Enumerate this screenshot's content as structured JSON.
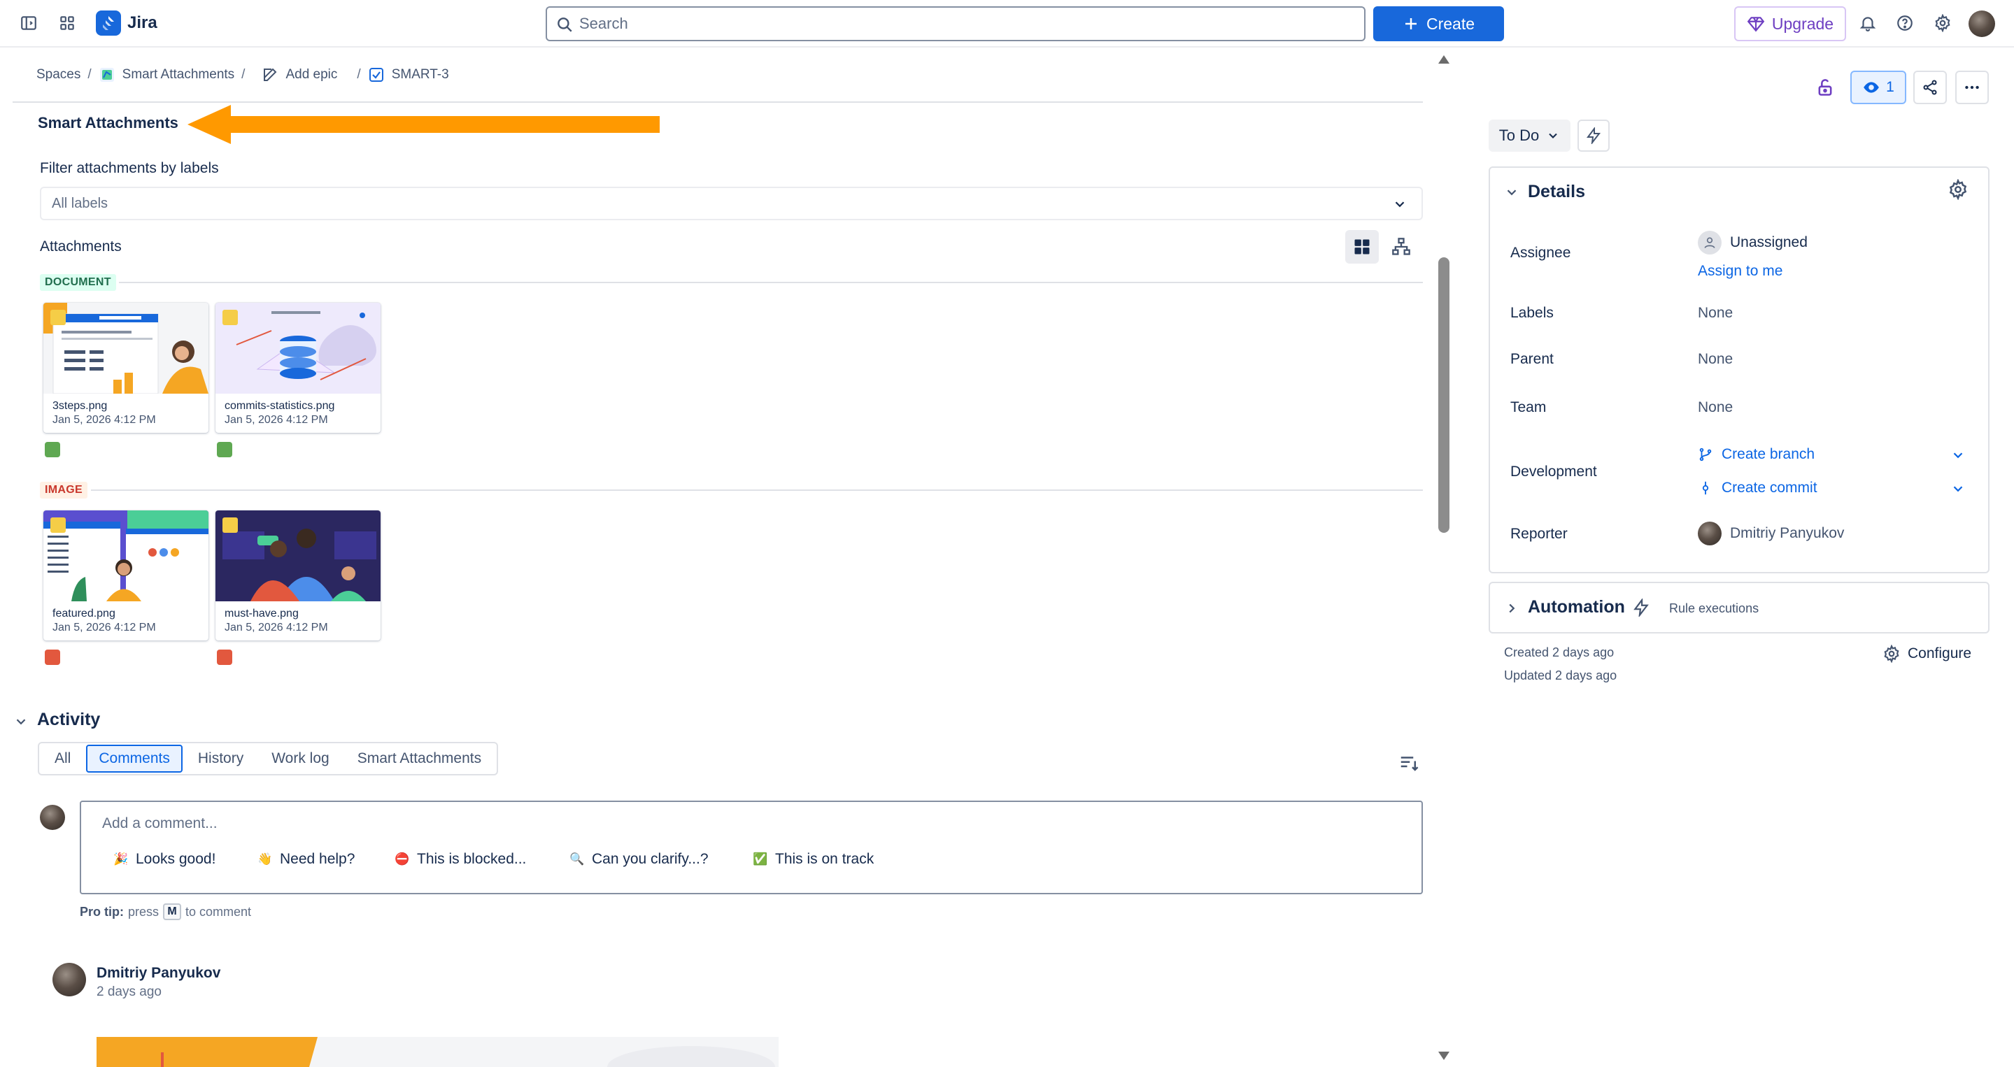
{
  "topnav": {
    "app_name": "Jira",
    "search_placeholder": "Search",
    "create_label": "Create",
    "upgrade_label": "Upgrade",
    "icons": [
      "sidebar-toggle-icon",
      "app-switcher-icon",
      "bell-icon",
      "help-icon",
      "settings-icon"
    ]
  },
  "breadcrumb": {
    "items": [
      "Spaces",
      "Smart Attachments",
      "Add epic",
      "SMART-3"
    ],
    "separator": "/"
  },
  "smart_attachments": {
    "title": "Smart Attachments",
    "filter_label": "Filter attachments by labels",
    "filter_value": "All labels",
    "attachments_label": "Attachments",
    "groups": [
      {
        "tag": "DOCUMENT",
        "color": "#5fa852",
        "files": [
          {
            "name": "3steps.png",
            "date": "Jan 5, 2026 4:12 PM"
          },
          {
            "name": "commits-statistics.png",
            "date": "Jan 5, 2026 4:12 PM"
          }
        ]
      },
      {
        "tag": "IMAGE",
        "color": "#e2583e",
        "files": [
          {
            "name": "featured.png",
            "date": "Jan 5, 2026 4:12 PM"
          },
          {
            "name": "must-have.png",
            "date": "Jan 5, 2026 4:12 PM"
          }
        ]
      }
    ]
  },
  "activity": {
    "title": "Activity",
    "tabs": [
      "All",
      "Comments",
      "History",
      "Work log",
      "Smart Attachments"
    ],
    "active_tab": "Comments",
    "comment_placeholder": "Add a comment...",
    "quick_replies": [
      {
        "emoji": "🎉",
        "label": "Looks good!"
      },
      {
        "emoji": "👋",
        "label": "Need help?"
      },
      {
        "emoji": "⛔",
        "label": "This is blocked..."
      },
      {
        "emoji": "🔍",
        "label": "Can you clarify...?"
      },
      {
        "emoji": "✅",
        "label": "This is on track"
      }
    ],
    "pro_tip_bold": "Pro tip:",
    "pro_tip_press": "press",
    "pro_tip_key": "M",
    "pro_tip_suffix": "to comment",
    "comment": {
      "author": "Dmitriy Panyukov",
      "time": "2 days ago"
    }
  },
  "right_panel": {
    "watch_count": "1",
    "status": "To Do",
    "details_title": "Details",
    "fields": {
      "assignee_label": "Assignee",
      "assignee_value": "Unassigned",
      "assign_to_me": "Assign to me",
      "labels_label": "Labels",
      "labels_value": "None",
      "parent_label": "Parent",
      "parent_value": "None",
      "team_label": "Team",
      "team_value": "None",
      "development_label": "Development",
      "create_branch": "Create branch",
      "create_commit": "Create commit",
      "reporter_label": "Reporter",
      "reporter_value": "Dmitriy Panyukov"
    },
    "automation_title": "Automation",
    "rule_executions": "Rule executions",
    "created": "Created 2 days ago",
    "updated": "Updated 2 days ago",
    "configure": "Configure"
  },
  "colors": {
    "brand": "#1868db",
    "link": "#0c66e4",
    "upgrade": "#6e3fc2",
    "annotation_arrow": "#ff9900"
  }
}
